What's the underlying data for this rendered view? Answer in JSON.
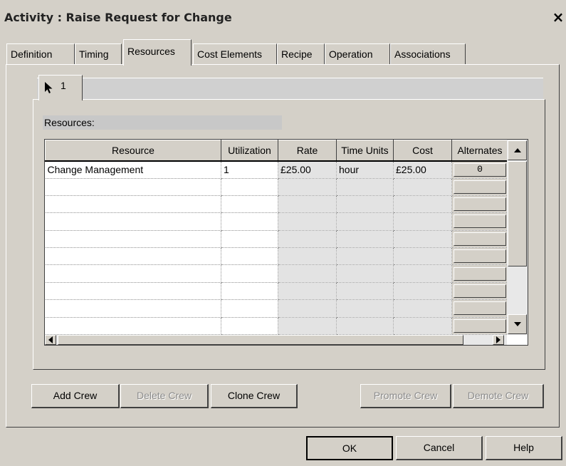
{
  "window": {
    "title": "Activity : Raise Request for Change",
    "close_label": "×"
  },
  "tabs": [
    "Definition",
    "Timing",
    "Resources",
    "Cost Elements",
    "Recipe",
    "Operation",
    "Associations"
  ],
  "active_tab": "Resources",
  "crew_tab": {
    "label": "1",
    "icon": "arrow-cursor-icon"
  },
  "resources_label": "Resources:",
  "grid": {
    "columns": [
      "Resource",
      "Utilization",
      "Rate",
      "Time Units",
      "Cost",
      "Alternates"
    ],
    "rows": [
      {
        "resource": "Change Management",
        "utilization": "1",
        "rate": "£25.00",
        "time_units": "hour",
        "cost": "£25.00",
        "alternates": "0"
      }
    ]
  },
  "crew_buttons": {
    "add": "Add Crew",
    "delete": "Delete Crew",
    "clone": "Clone Crew",
    "promote": "Promote Crew",
    "demote": "Demote Crew"
  },
  "dialog_buttons": {
    "ok": "OK",
    "cancel": "Cancel",
    "help": "Help"
  }
}
